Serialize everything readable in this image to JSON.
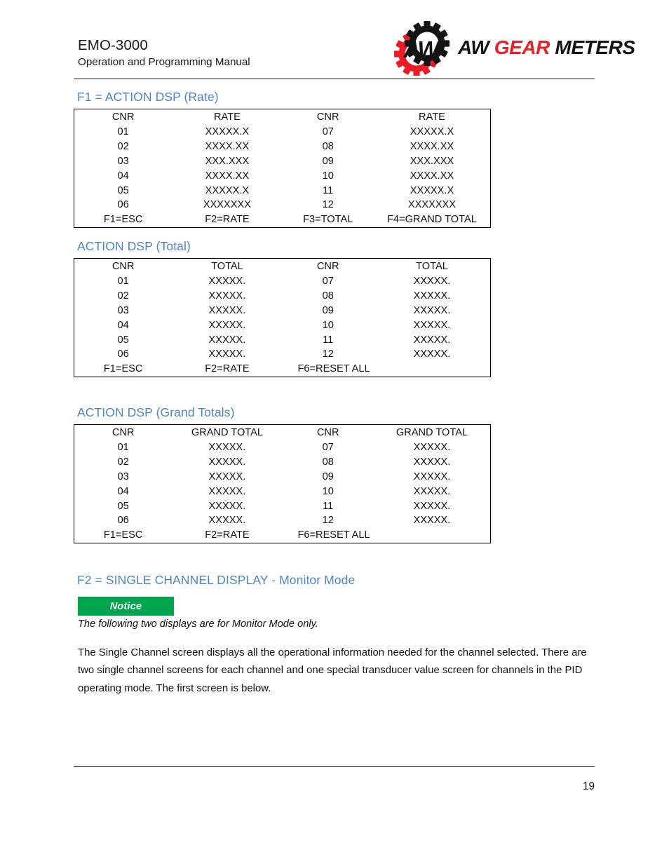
{
  "document": {
    "model": "EMO-3000",
    "subtitle": "Operation and Programming Manual",
    "page_number": "19"
  },
  "logo": {
    "mark_name": "aw-gear-meters-gear-logo",
    "word_1": "AW",
    "word_2": "GEAR",
    "word_3": "METERS",
    "colors": {
      "red": "#e8202a",
      "black": "#141414"
    }
  },
  "colors": {
    "heading_blue": "#4b86c6",
    "notice_green": "#00a44c",
    "rule_black": "#111111"
  },
  "sections": [
    {
      "heading": "F1 = ACTION DSP (Rate)",
      "table": {
        "headers": [
          "CNR",
          "RATE",
          "CNR",
          "RATE"
        ],
        "rows": [
          [
            "01",
            "XXXXX.X",
            "07",
            "XXXXX.X"
          ],
          [
            "02",
            "XXXX.XX",
            "08",
            "XXXX.XX"
          ],
          [
            "03",
            "XXX.XXX",
            "09",
            "XXX.XXX"
          ],
          [
            "04",
            "XXXX.XX",
            "10",
            "XXXX.XX"
          ],
          [
            "05",
            "XXXXX.X",
            "11",
            "XXXXX.X"
          ],
          [
            "06",
            "XXXXXXX",
            "12",
            "XXXXXXX"
          ]
        ],
        "footer": [
          "F1=ESC",
          "F2=RATE",
          "F3=TOTAL",
          "F4=GRAND TOTAL"
        ],
        "footer_align": [
          "center",
          "center",
          "center",
          "center"
        ]
      }
    },
    {
      "heading": "ACTION DSP (Total)",
      "table": {
        "headers": [
          "CNR",
          "TOTAL",
          "CNR",
          "TOTAL"
        ],
        "rows": [
          [
            "01",
            "XXXXX.",
            "07",
            "XXXXX."
          ],
          [
            "02",
            "XXXXX.",
            "08",
            "XXXXX."
          ],
          [
            "03",
            "XXXXX.",
            "09",
            "XXXXX."
          ],
          [
            "04",
            "XXXXX.",
            "10",
            "XXXXX."
          ],
          [
            "05",
            "XXXXX.",
            "11",
            "XXXXX."
          ],
          [
            "06",
            "XXXXX.",
            "12",
            "XXXXX."
          ]
        ],
        "footer": [
          "F1=ESC",
          "F2=RATE",
          "F6=RESET ALL",
          ""
        ],
        "footer_align": [
          "center",
          "center",
          "left",
          "center"
        ]
      }
    },
    {
      "heading": "ACTION DSP (Grand Totals)",
      "table": {
        "headers": [
          "CNR",
          "GRAND TOTAL",
          "CNR",
          "GRAND TOTAL"
        ],
        "rows": [
          [
            "01",
            "XXXXX.",
            "07",
            "XXXXX."
          ],
          [
            "02",
            "XXXXX.",
            "08",
            "XXXXX."
          ],
          [
            "03",
            "XXXXX.",
            "09",
            "XXXXX."
          ],
          [
            "04",
            "XXXXX.",
            "10",
            "XXXXX."
          ],
          [
            "05",
            "XXXXX.",
            "11",
            "XXXXX."
          ],
          [
            "06",
            "XXXXX.",
            "12",
            "XXXXX."
          ]
        ],
        "footer": [
          "F1=ESC",
          "F2=RATE",
          "F6=RESET ALL",
          ""
        ],
        "footer_align": [
          "center",
          "center",
          "left",
          "center"
        ]
      }
    }
  ],
  "monitor_section": {
    "heading": "F2 = SINGLE CHANNEL DISPLAY - Monitor Mode",
    "notice_label": "Notice",
    "notice_text": "The following two displays are for Monitor Mode only.",
    "paragraph": "The Single Channel screen displays all the operational information needed for the channel selected. There are two single channel screens for each channel and one special transducer value screen for channels in the PID operating mode. The first screen is below."
  }
}
